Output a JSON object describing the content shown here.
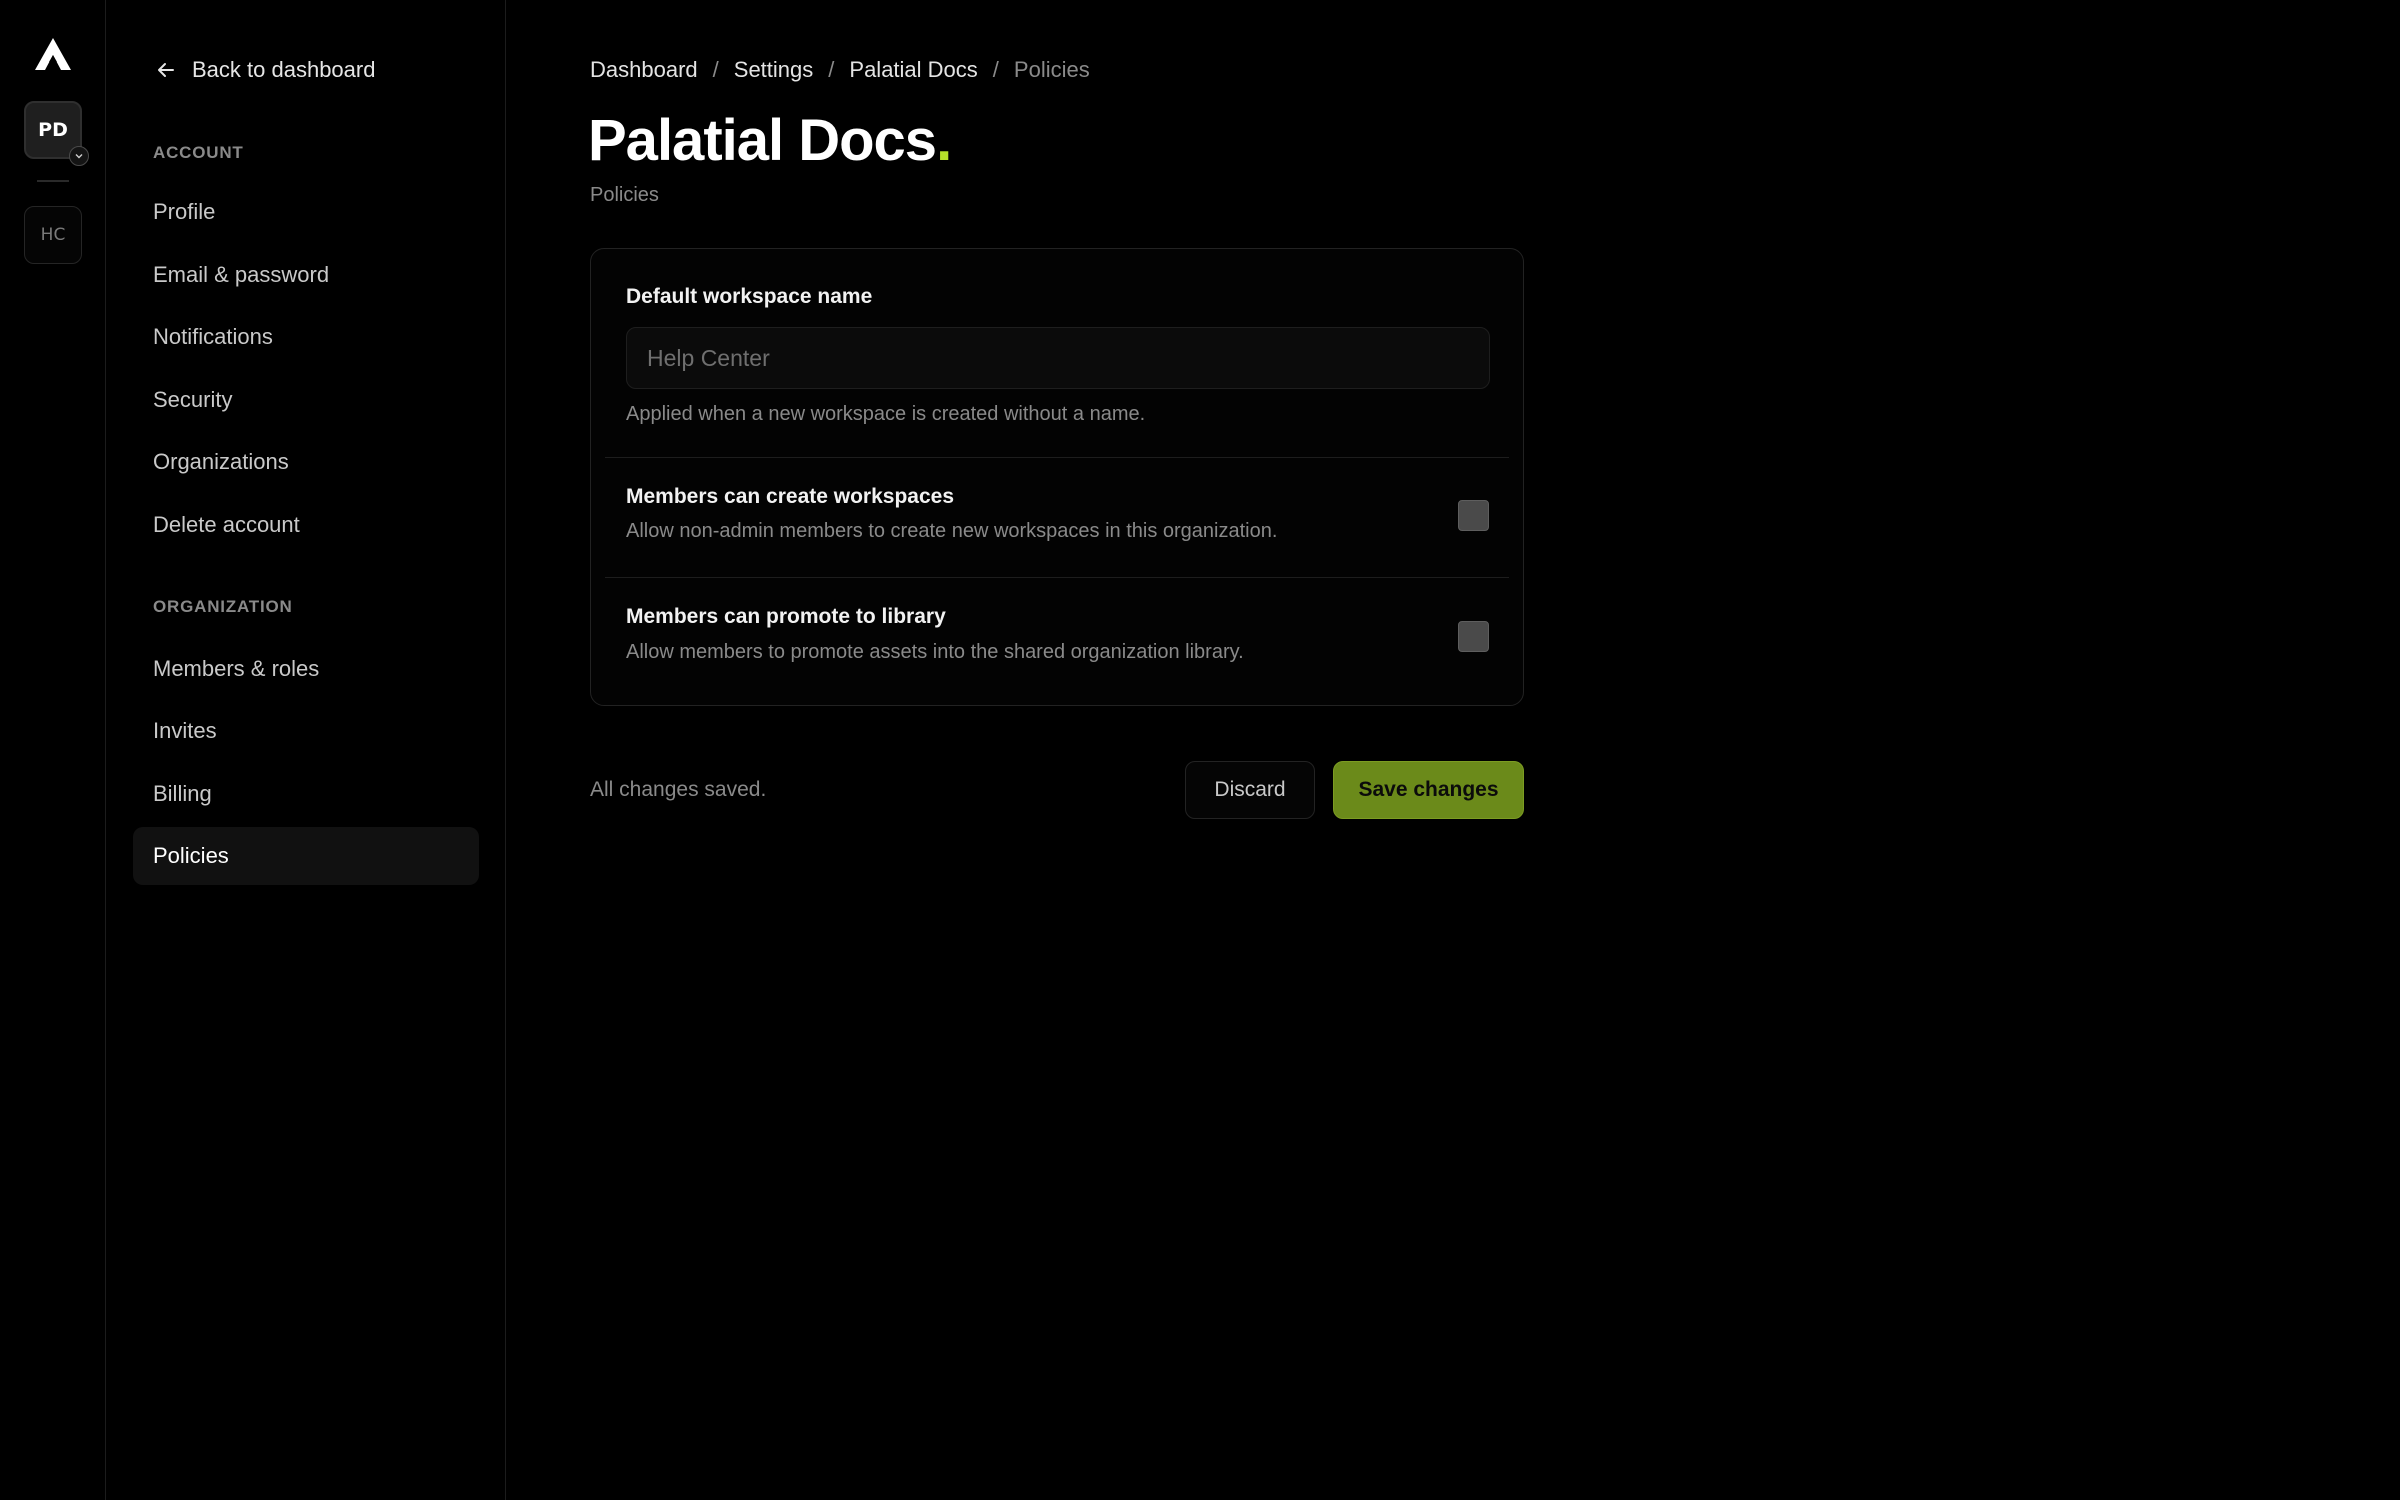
{
  "rail": {
    "orgs": [
      {
        "initials": "PD",
        "active": true
      },
      {
        "initials": "HC",
        "active": false
      }
    ]
  },
  "sidebar": {
    "back_label": "Back to dashboard",
    "sections": [
      {
        "label": "ACCOUNT",
        "items": [
          "Profile",
          "Email & password",
          "Notifications",
          "Security",
          "Organizations",
          "Delete account"
        ]
      },
      {
        "label": "ORGANIZATION",
        "items": [
          "Members & roles",
          "Invites",
          "Billing",
          "Policies"
        ]
      }
    ],
    "active_item": "Policies"
  },
  "breadcrumb": [
    "Dashboard",
    "Settings",
    "Palatial Docs",
    "Policies"
  ],
  "page": {
    "title": "Palatial Docs",
    "title_dot": ".",
    "subtitle": "Policies"
  },
  "form": {
    "workspace_name": {
      "label": "Default workspace name",
      "value": "",
      "placeholder": "Help Center",
      "help": "Applied when a new workspace is created without a name."
    },
    "create_workspaces": {
      "title": "Members can create workspaces",
      "description": "Allow non-admin members to create new workspaces in this organization.",
      "checked": false
    },
    "promote_library": {
      "title": "Members can promote to library",
      "description": "Allow members to promote assets into the shared organization library.",
      "checked": false
    }
  },
  "footer": {
    "status": "All changes saved.",
    "discard_label": "Discard",
    "save_label": "Save changes"
  },
  "colors": {
    "accent": "#b6e02a",
    "save_button": "#6b8a1a",
    "background": "#000000"
  }
}
